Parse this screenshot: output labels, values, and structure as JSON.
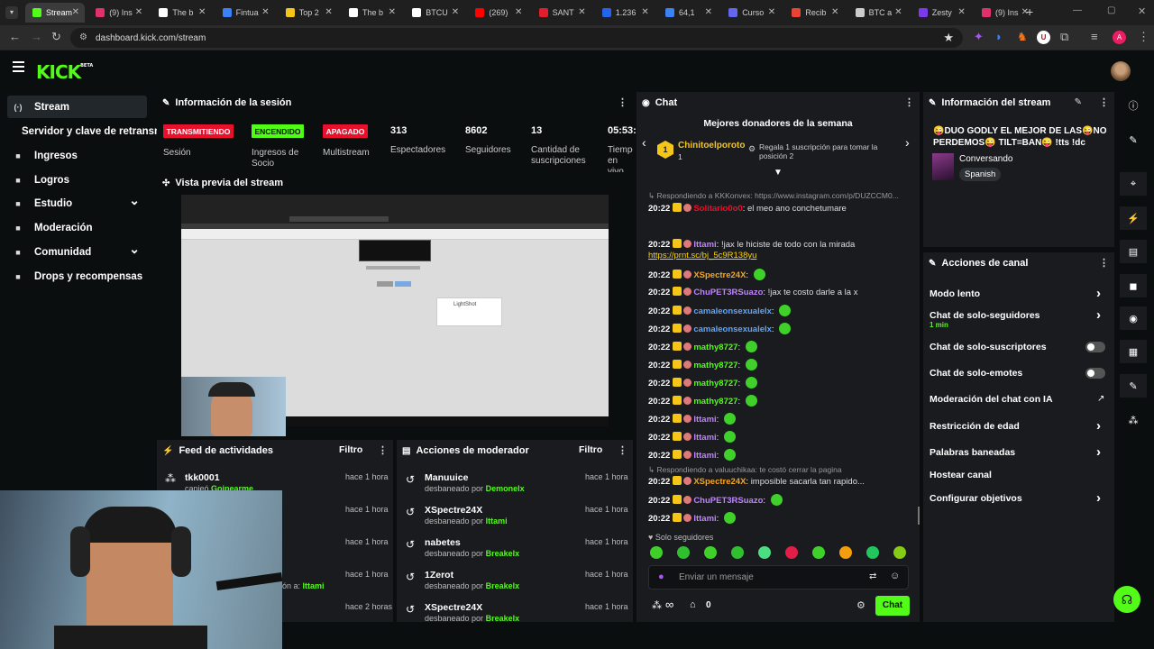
{
  "browser": {
    "tabs": [
      {
        "title": "Stream",
        "color": "#53fc18"
      },
      {
        "title": "(9) Ins",
        "color": "#e1306c"
      },
      {
        "title": "The b",
        "color": "#ffffff"
      },
      {
        "title": "Fintua",
        "color": "#3b82f6"
      },
      {
        "title": "Top 2",
        "color": "#f5c518"
      },
      {
        "title": "The b",
        "color": "#ffffff"
      },
      {
        "title": "BTCU",
        "color": "#ffffff"
      },
      {
        "title": "(269)",
        "color": "#ff0000"
      },
      {
        "title": "SANT",
        "color": "#e11d2e"
      },
      {
        "title": "1.236",
        "color": "#2563eb"
      },
      {
        "title": "64,1",
        "color": "#3b82f6"
      },
      {
        "title": "Curso",
        "color": "#6366f1"
      },
      {
        "title": "Recib",
        "color": "#ea4335"
      },
      {
        "title": "BTC a",
        "color": "#cccccc"
      },
      {
        "title": "Zesty",
        "color": "#7c3aed"
      },
      {
        "title": "(9) Ins",
        "color": "#e1306c"
      }
    ],
    "url": "dashboard.kick.com/stream"
  },
  "sidebar": {
    "items": [
      {
        "label": "Stream",
        "icon": "broadcast-icon"
      },
      {
        "label": "Servidor y clave de retransm",
        "icon": ""
      },
      {
        "label": "Ingresos",
        "icon": "grid-icon"
      },
      {
        "label": "Logros",
        "icon": "trophy-icon"
      },
      {
        "label": "Estudio",
        "icon": "palette-icon"
      },
      {
        "label": "Moderación",
        "icon": "wrench-icon"
      },
      {
        "label": "Comunidad",
        "icon": "users-icon"
      },
      {
        "label": "Drops y recompensas",
        "icon": "gift-icon"
      }
    ]
  },
  "session": {
    "title": "Información de la sesión",
    "badges": [
      {
        "label": "TRANSMITIENDO",
        "caption": "Sesión",
        "bg": "#e8102a",
        "fg": "#ffffff"
      },
      {
        "label": "ENCENDIDO",
        "caption": "Ingresos de Socio",
        "bg": "#53fc18",
        "fg": "#0b0e0f"
      },
      {
        "label": "APAGADO",
        "caption": "Multistream",
        "bg": "#e8102a",
        "fg": "#ffffff"
      }
    ],
    "stats": [
      {
        "value": "313",
        "label": "Espectadores"
      },
      {
        "value": "8602",
        "label": "Seguidores"
      },
      {
        "value": "13",
        "label": "Cantidad de suscripciones"
      },
      {
        "value": "05:53:",
        "label": "Tiempo en vivo"
      }
    ]
  },
  "preview": {
    "title": "Vista previa del stream",
    "lightshot": "LightShot"
  },
  "activity": {
    "title": "Feed de actividades",
    "filter": "Filtro",
    "items": [
      {
        "name": "tkk0001",
        "sub": "canjeó",
        "user": "Goipearme",
        "time": "hace 1 hora"
      },
      {
        "name": "",
        "sub": "",
        "user": "",
        "time": "hace 1 hora"
      },
      {
        "name": "",
        "sub": "",
        "user": "",
        "time": "hace 1 hora"
      },
      {
        "name": "",
        "sub": "ón a:",
        "user": "Ittami",
        "time": "hace 1 hora"
      },
      {
        "name": "",
        "sub": "",
        "user": "",
        "time": "hace 2 horas"
      }
    ]
  },
  "modactions": {
    "title": "Acciones de moderador",
    "filter": "Filtro",
    "items": [
      {
        "name": "Manuuice",
        "sub": "desbaneado por",
        "by": "Demonelx",
        "time": "hace 1 hora"
      },
      {
        "name": "XSpectre24X",
        "sub": "desbaneado por",
        "by": "Ittami",
        "time": "hace 1 hora"
      },
      {
        "name": "nabetes",
        "sub": "desbaneado por",
        "by": "Breakelx",
        "time": "hace 1 hora"
      },
      {
        "name": "1Zerot",
        "sub": "desbaneado por",
        "by": "Breakelx",
        "time": "hace 1 hora"
      },
      {
        "name": "XSpectre24X",
        "sub": "desbaneado por",
        "by": "Breakelx",
        "time": "hace 1 hora"
      }
    ]
  },
  "chat": {
    "title": "Chat",
    "donors_title": "Mejores donadores de la semana",
    "donor": {
      "rank": "1",
      "name": "Chinitoelporoto",
      "count": "1",
      "promo": "Regala 1 suscripción para tomar la posición 2"
    },
    "reply1": "Respondiendo a KKKonvex: https://www.instagram.com/p/DUZCCM0...",
    "messages": [
      {
        "time": "20:22",
        "user": "Solitario0o0",
        "color": "#e8102a",
        "text": "el meo ano conchetumare",
        "emote": false
      },
      {
        "time": "20:22",
        "user": "Ittami",
        "color": "#c084fc",
        "text": "!jax le hiciste de todo con la mirada",
        "emote": false
      },
      {
        "time": "",
        "user": "",
        "color": "#ffd400",
        "text": "https://prnt.sc/bj_5c9R138yu",
        "emote": false
      },
      {
        "time": "20:22",
        "user": "XSpectre24X",
        "color": "#f5a623",
        "text": "",
        "emote": true
      },
      {
        "time": "20:22",
        "user": "ChuPET3RSuazo",
        "color": "#c084fc",
        "text": "!jax te costo darle a la x",
        "emote": false
      },
      {
        "time": "20:22",
        "user": "camaleonsexualelx",
        "color": "#60a5fa",
        "text": "",
        "emote": true
      },
      {
        "time": "20:22",
        "user": "camaleonsexualelx",
        "color": "#60a5fa",
        "text": "",
        "emote": true
      },
      {
        "time": "20:22",
        "user": "mathy8727",
        "color": "#53fc18",
        "text": "",
        "emote": true
      },
      {
        "time": "20:22",
        "user": "mathy8727",
        "color": "#53fc18",
        "text": "",
        "emote": true
      },
      {
        "time": "20:22",
        "user": "mathy8727",
        "color": "#53fc18",
        "text": "",
        "emote": true
      },
      {
        "time": "20:22",
        "user": "mathy8727",
        "color": "#53fc18",
        "text": "",
        "emote": true
      },
      {
        "time": "20:22",
        "user": "Ittami",
        "color": "#c084fc",
        "text": "",
        "emote": true
      },
      {
        "time": "20:22",
        "user": "Ittami",
        "color": "#c084fc",
        "text": "",
        "emote": true
      },
      {
        "time": "20:22",
        "user": "Ittami",
        "color": "#c084fc",
        "text": "",
        "emote": true
      }
    ],
    "reply2": "Respondiendo a valuuchikaa: te costó cerrar la pagina",
    "messages2": [
      {
        "time": "20:22",
        "user": "XSpectre24X",
        "color": "#f5a623",
        "text": "imposible sacarla tan rapido...",
        "emote": false
      },
      {
        "time": "20:22",
        "user": "ChuPET3RSuazo",
        "color": "#c084fc",
        "text": "",
        "emote": true
      },
      {
        "time": "20:22",
        "user": "Ittami",
        "color": "#c084fc",
        "text": "",
        "emote": true
      }
    ],
    "followers_only": "Solo seguidores",
    "input_placeholder": "Enviar un mensaje",
    "infinity": "∞",
    "zero": "0",
    "send": "Chat"
  },
  "streaminfo": {
    "title": "Información del stream",
    "stream_title": "😜DUO GODLY EL MEJOR DE LAS😜NO PERDEMOS😜 TILT=BAN😜 !tts !dc",
    "category": "Conversando",
    "language": "Spanish"
  },
  "channel": {
    "title": "Acciones de canal",
    "actions": [
      {
        "label": "Modo lento",
        "sub": "",
        "control": "chevron"
      },
      {
        "label": "Chat de solo-seguidores",
        "sub": "1 min",
        "control": "chevron"
      },
      {
        "label": "Chat de solo-suscriptores",
        "sub": "",
        "control": "toggle"
      },
      {
        "label": "Chat de solo-emotes",
        "sub": "",
        "control": "toggle"
      },
      {
        "label": "Moderación del chat con IA",
        "sub": "",
        "control": "external"
      },
      {
        "label": "Restricción de edad",
        "sub": "",
        "control": "chevron"
      },
      {
        "label": "Palabras baneadas",
        "sub": "",
        "control": "chevron"
      },
      {
        "label": "Hostear canal",
        "sub": "",
        "control": "none"
      },
      {
        "label": "Configurar objetivos",
        "sub": "",
        "control": "chevron"
      }
    ]
  },
  "colors": {
    "brand": "#53fc18",
    "live": "#e8102a",
    "panel": "#191b1f",
    "bg": "#0b0e0f"
  }
}
